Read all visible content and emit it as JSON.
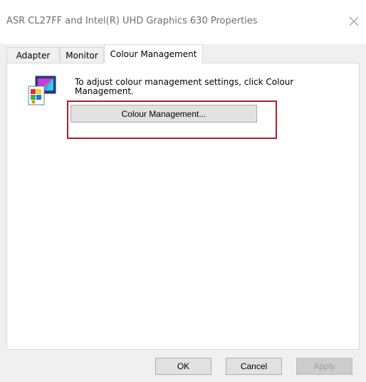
{
  "window": {
    "title": "ASR CL27FF and Intel(R) UHD Graphics 630 Properties",
    "close_icon": "close-icon"
  },
  "tabs": [
    {
      "label": "Adapter",
      "active": false
    },
    {
      "label": "Monitor",
      "active": false
    },
    {
      "label": "Colour Management",
      "active": true
    }
  ],
  "colour_management": {
    "icon": "colour-management-icon",
    "description": "To adjust colour management settings, click Colour Management.",
    "button_label": "Colour Management..."
  },
  "footer": {
    "ok_label": "OK",
    "cancel_label": "Cancel",
    "apply_label": "Apply",
    "apply_enabled": false
  },
  "colors": {
    "highlight": "#b0202a",
    "button_face": "#e1e1e1",
    "dialog_background": "#f0f0f0"
  }
}
